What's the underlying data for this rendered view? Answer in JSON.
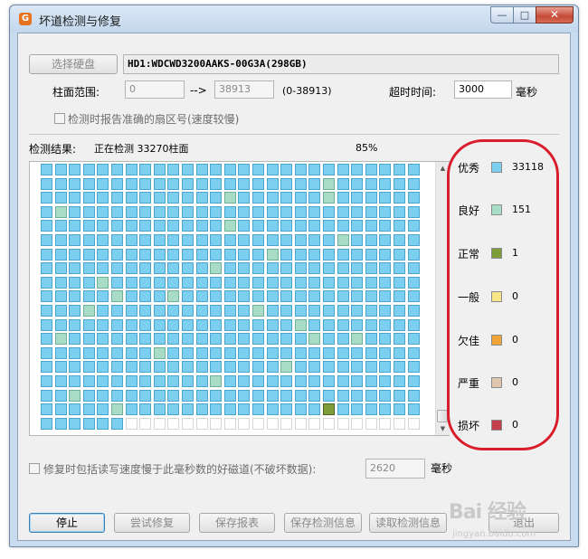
{
  "window": {
    "title": "坏道检测与修复",
    "app_icon": "G",
    "min_icon": "—",
    "max_icon": "□",
    "close_icon": "✕"
  },
  "disk": {
    "select_button": "选择硬盘",
    "name": "HD1:WDCWD3200AAKS-00G3A(298GB)"
  },
  "range": {
    "label": "柱面范围:",
    "start": "0",
    "arrow": "-->",
    "end": "38913",
    "hint": "(0-38913)"
  },
  "timeout": {
    "label": "超时时间:",
    "value": "3000",
    "unit": "毫秒"
  },
  "report_option": {
    "label": "检测时报告准确的扇区号(速度较慢)"
  },
  "result": {
    "label": "检测结果:",
    "status": "正在检测  33270柱面",
    "percent": "85%"
  },
  "grid": {
    "columns": 27,
    "rows": 19,
    "filled_last_row": 6,
    "colors": {
      "excellent": "#7dcff0",
      "good": "#a8dcc6",
      "normal": "#7f9c3a",
      "empty": "#ffffff"
    }
  },
  "legend": [
    {
      "label": "优秀",
      "count": "33118",
      "color": "#7dcff0"
    },
    {
      "label": "良好",
      "count": "151",
      "color": "#a8dcc6"
    },
    {
      "label": "正常",
      "count": "1",
      "color": "#7f9c3a"
    },
    {
      "label": "一般",
      "count": "0",
      "color": "#f8e58a"
    },
    {
      "label": "欠佳",
      "count": "0",
      "color": "#f0a536"
    },
    {
      "label": "严重",
      "count": "0",
      "color": "#dfc5ae"
    },
    {
      "label": "损坏",
      "count": "0",
      "color": "#c33f4c"
    }
  ],
  "repair_option": {
    "label": "修复时包括读写速度慢于此毫秒数的好磁道(不破坏数据):",
    "value": "2620",
    "unit": "毫秒"
  },
  "buttons": {
    "stop": "停止",
    "try_repair": "尝试修复",
    "save_report": "保存报表",
    "save_info": "保存检测信息",
    "load_info": "读取检测信息",
    "exit": "退出"
  },
  "watermark": {
    "text": "Bai 经验",
    "sub": "jingyan.baidu.com"
  }
}
